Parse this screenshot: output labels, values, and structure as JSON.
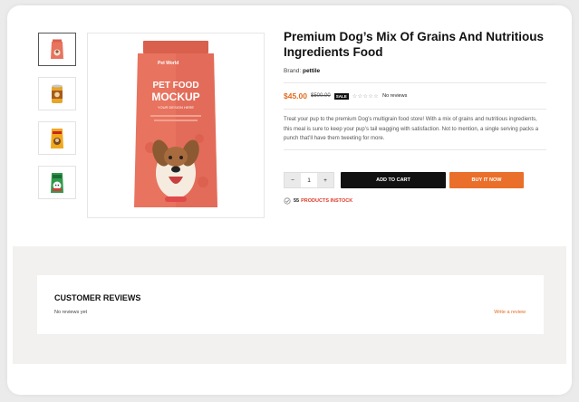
{
  "product": {
    "title": "Premium Dog’s Mix Of Grains And Nutritious Ingredients Food",
    "brand_label": "Brand:",
    "brand_name": "pettile",
    "price": "$45.00",
    "compare_price": "$500.00",
    "sale_badge": "SALE",
    "rating_stars": "☆☆☆☆☆",
    "reviews_text": "No reviews",
    "description": "Treat your pup to the premium Dog’s multigrain food store! With a mix of grains and nutritious ingredients, this meal is sure to keep your pup’s tail wagging with satisfaction. Not to mention, a single serving packs a punch that’ll have them tweeting for more.",
    "image_brand": "Pet World",
    "image_line1": "PET FOOD",
    "image_line2": "MOCKUP",
    "image_tagline": "YOUR DESIGN HERE"
  },
  "quantity": {
    "minus": "−",
    "value": "1",
    "plus": "+"
  },
  "buttons": {
    "add_to_cart": "ADD TO CART",
    "buy_now": "BUY IT NOW"
  },
  "stock": {
    "count": "55",
    "label": "PRODUCTS INSTOCK"
  },
  "reviews": {
    "title": "CUSTOMER REVIEWS",
    "empty": "No reviews yet",
    "write": "Write a review"
  },
  "colors": {
    "accent": "#e26a1f",
    "bag": "#e8735f",
    "stock_red": "#e03a2a"
  }
}
